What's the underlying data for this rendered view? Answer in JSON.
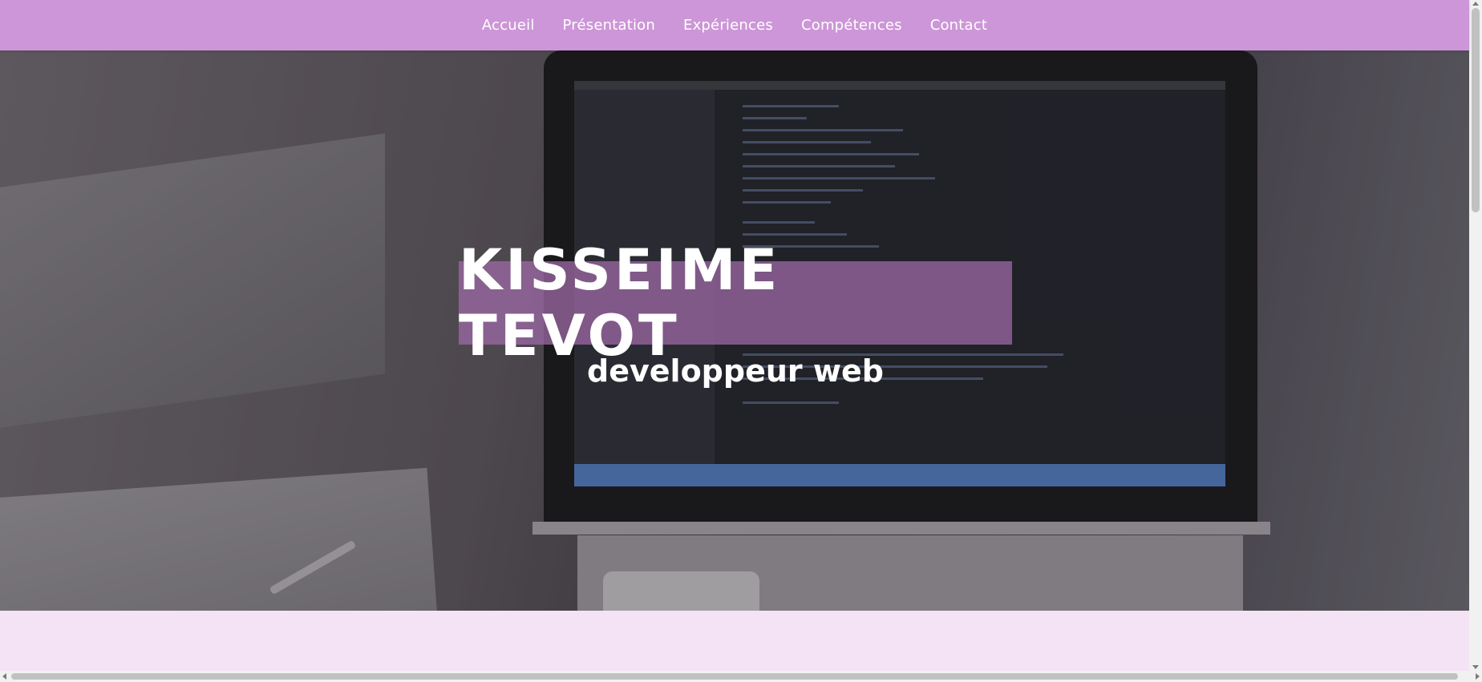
{
  "nav": {
    "items": [
      {
        "label": "Accueil"
      },
      {
        "label": "Présentation"
      },
      {
        "label": "Expériences"
      },
      {
        "label": "Compétences"
      },
      {
        "label": "Contact"
      }
    ]
  },
  "hero": {
    "title": "KISSEIME TEVOT",
    "subtitle": "developpeur web",
    "background_image": "laptop-with-code-editor-photo"
  },
  "colors": {
    "navbar": "#cd96d8",
    "title_box": "#9d6aa7",
    "page_background": "#f3e3f5",
    "text": "#ffffff"
  }
}
